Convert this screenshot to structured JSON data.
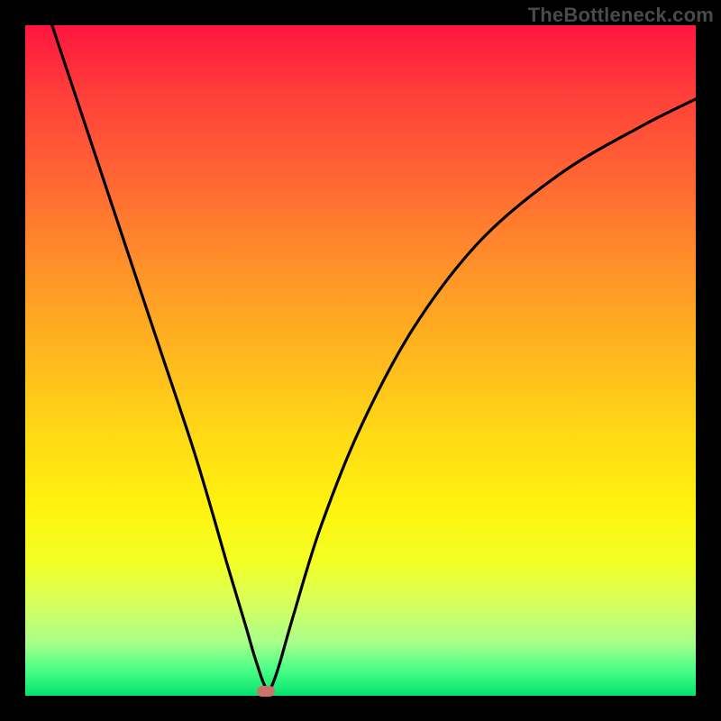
{
  "watermark": "TheBottleneck.com",
  "chart_data": {
    "type": "line",
    "title": "",
    "xlabel": "",
    "ylabel": "",
    "xlim": [
      0,
      100
    ],
    "ylim": [
      0,
      100
    ],
    "series": [
      {
        "name": "bottleneck-curve",
        "x": [
          4,
          10,
          15,
          20,
          25,
          28,
          30,
          31.5,
          33,
          34,
          34.8,
          35.3,
          35.8,
          36,
          36.3,
          37,
          38,
          40,
          44,
          50,
          58,
          68,
          80,
          92,
          100
        ],
        "values": [
          100,
          82,
          67,
          52,
          37,
          27,
          20,
          15,
          10,
          6.5,
          4,
          2.5,
          1.3,
          0.7,
          0.7,
          2,
          5,
          12,
          25,
          40,
          55,
          68,
          78,
          85,
          89
        ]
      }
    ],
    "marker": {
      "x": 35.9,
      "y": 0.7,
      "color": "#c9736b"
    },
    "gradient_stops": [
      {
        "pct": 0,
        "color": "#ff153f"
      },
      {
        "pct": 24,
        "color": "#ff6a33"
      },
      {
        "pct": 48,
        "color": "#ffb41f"
      },
      {
        "pct": 72,
        "color": "#fff30e"
      },
      {
        "pct": 100,
        "color": "#04e36e"
      }
    ],
    "grid": false,
    "legend": false
  }
}
